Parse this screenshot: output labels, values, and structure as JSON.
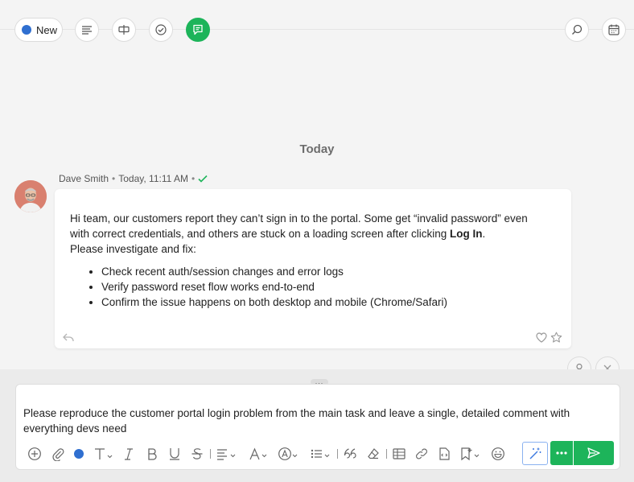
{
  "header": {
    "new_button_label": "New",
    "status_dot_color": "#2f6fd0",
    "accent_color": "#1db45a",
    "icons": [
      "description-icon",
      "checklist-icon",
      "check-circle-icon",
      "comment-icon",
      "search-icon",
      "calendar-icon"
    ]
  },
  "feed": {
    "date_divider": "Today",
    "message": {
      "author": "Dave Smith",
      "separator": "•",
      "timestamp": "Today, 11:11 AM",
      "intro_line_1": "Hi team, our customers report they can’t sign in to the portal. Some get “invalid password” even",
      "intro_line_2_prefix": "with correct credentials, and others are stuck on a loading screen after clicking ",
      "intro_line_2_bold": "Log In",
      "intro_line_2_suffix": ".",
      "intro_line_3": "Please investigate and fix:",
      "bullets": [
        "Check recent auth/session changes and error logs",
        "Verify password reset flow works end-to-end",
        "Confirm the issue happens on both desktop and mobile (Chrome/Safari)"
      ]
    }
  },
  "composer": {
    "draft_text": "Please reproduce the customer portal login problem from the main task and leave a single, detailed comment with everything devs need",
    "text_color_dot": "#2f6fd0",
    "grip_label": "..."
  }
}
